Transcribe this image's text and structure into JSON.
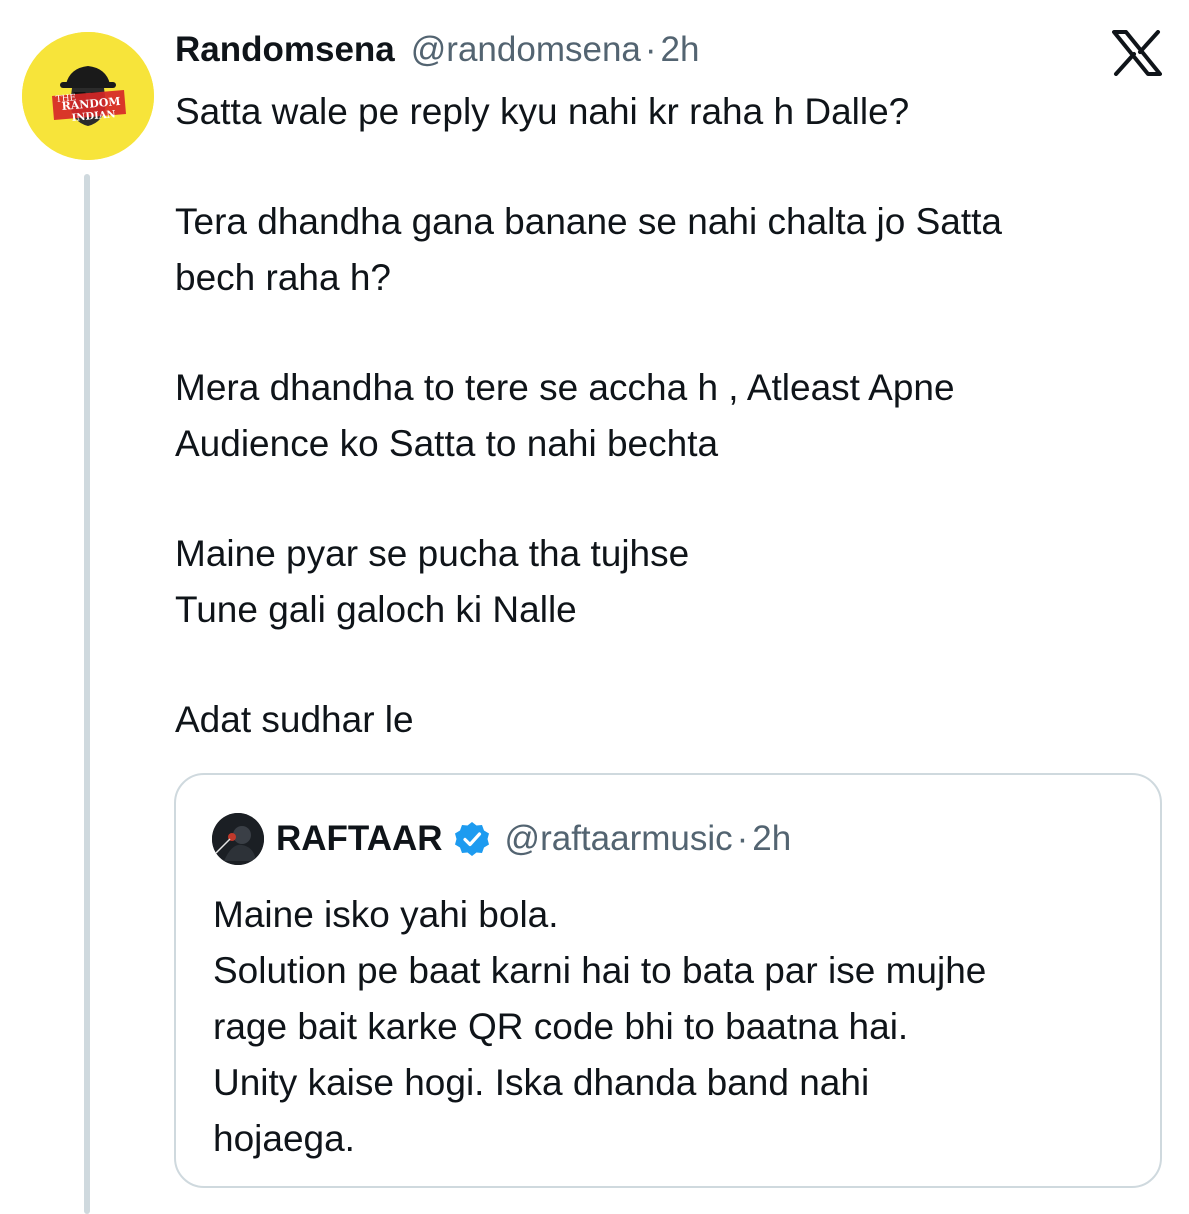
{
  "tweet": {
    "author": {
      "display_name": "Randomsena",
      "handle": "@randomsena",
      "avatar_text": [
        "THE",
        "RANDOM",
        "INDIAN"
      ],
      "avatar_bg": "#f7e43a"
    },
    "separator": "·",
    "time": "2h",
    "platform_icon": "x-logo-icon",
    "paragraphs": [
      [
        "Satta wale pe reply kyu nahi kr raha h Dalle?"
      ],
      [
        "Tera dhandha gana banane se nahi chalta jo Satta",
        "bech raha h?"
      ],
      [
        "Mera dhandha to tere se accha h , Atleast Apne",
        "Audience ko Satta to nahi bechta"
      ],
      [
        "Maine pyar se pucha tha tujhse",
        "Tune gali galoch ki Nalle"
      ],
      [
        "Adat sudhar le"
      ]
    ]
  },
  "quoted_tweet": {
    "display_name": "RAFTAAR",
    "verified": true,
    "verified_color": "#1d9bf0",
    "handle": "@raftaarmusic",
    "separator": "·",
    "time": "2h",
    "lines": [
      "Maine isko yahi bola.",
      "Solution pe baat karni hai to bata par ise mujhe",
      "rage bait karke QR code bhi to baatna hai.",
      "Unity kaise hogi. Iska dhanda band nahi",
      "hojaega."
    ]
  },
  "colors": {
    "text_primary": "#0f1419",
    "text_secondary": "#536471",
    "border": "#cfd9de"
  }
}
